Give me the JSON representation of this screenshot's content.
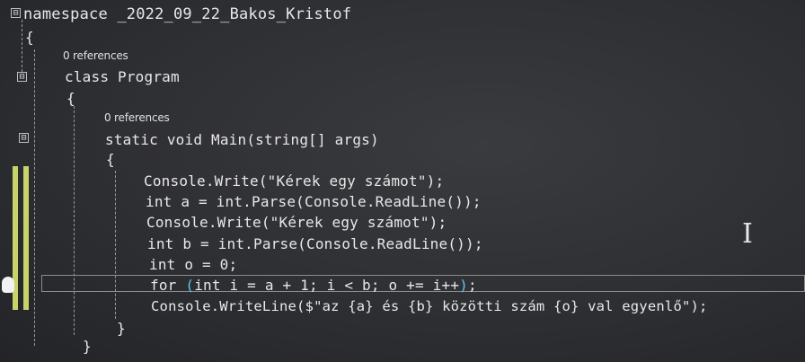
{
  "editor": {
    "lines": {
      "namespace": "namespace _2022_09_22_Bakos_Kristof",
      "ns_open": "{",
      "class_decl": "class Program",
      "class_open": "{",
      "main_decl": "static void Main(string[] args)",
      "main_open": "{",
      "l1": "Console.Write(\"Kérek egy számot\");",
      "l2": "int a = int.Parse(Console.ReadLine());",
      "l3": "Console.Write(\"Kérek egy számot\");",
      "l4": "int b = int.Parse(Console.ReadLine());",
      "l5": "int o = 0;",
      "l6_kw": "for ",
      "l6_open": "(",
      "l6_body": "int i = a + 1; i < b; o += i++",
      "l6_close": ")",
      "l6_end": ";",
      "l7": "Console.WriteLine($\"az {a} és {b} közötti szám {o} val egyenlő\");",
      "main_close": "}",
      "class_close": "}"
    },
    "codelens": {
      "class_refs": "0 references",
      "main_refs": "0 references"
    },
    "fold_icons": {
      "collapse": "⊟"
    },
    "colors": {
      "change_bar": "#c8d36a",
      "brace_match": "#5ec8e8"
    }
  }
}
